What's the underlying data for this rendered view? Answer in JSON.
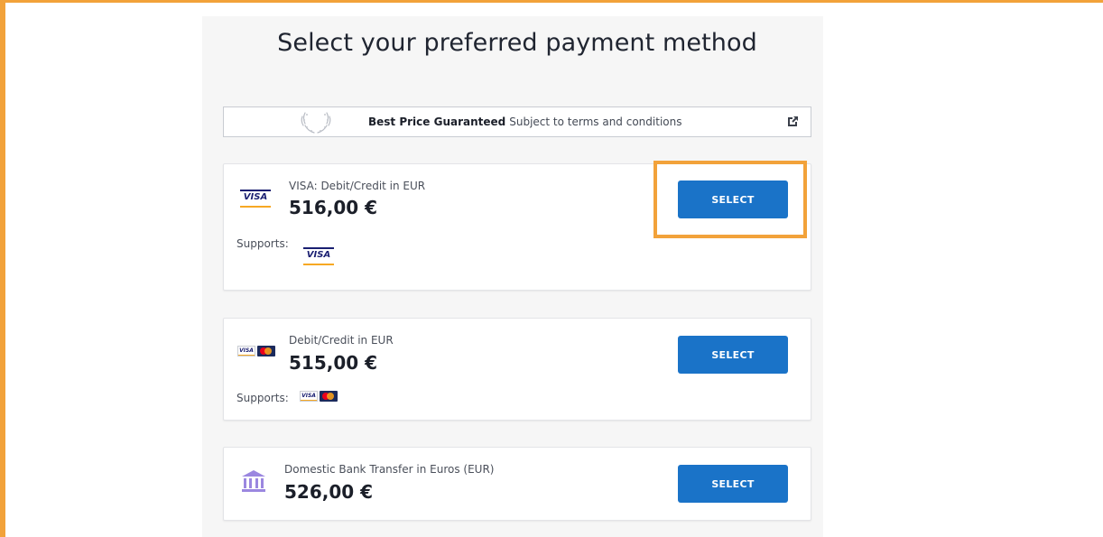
{
  "page": {
    "title": "Select your preferred payment method"
  },
  "promo": {
    "bold_text": "Best Price Guaranteed",
    "sub_text": "Subject to terms and conditions"
  },
  "methods": [
    {
      "name": "VISA: Debit/Credit in EUR",
      "price": "516,00 €",
      "supports_label": "Supports:",
      "select_label": "SELECT",
      "logo_text": "VISA",
      "highlighted": true
    },
    {
      "name": "Debit/Credit in EUR",
      "price": "515,00 €",
      "supports_label": "Supports:",
      "select_label": "SELECT",
      "logo_text": "VISA"
    },
    {
      "name": "Domestic Bank Transfer in Euros (EUR)",
      "price": "526,00 €",
      "select_label": "SELECT"
    }
  ],
  "colors": {
    "accent_frame": "#f2a23a",
    "button_blue": "#1a73c8",
    "visa_blue": "#1a1f71",
    "visa_gold": "#f7a823",
    "bank_icon_purple": "#9b87e0"
  }
}
